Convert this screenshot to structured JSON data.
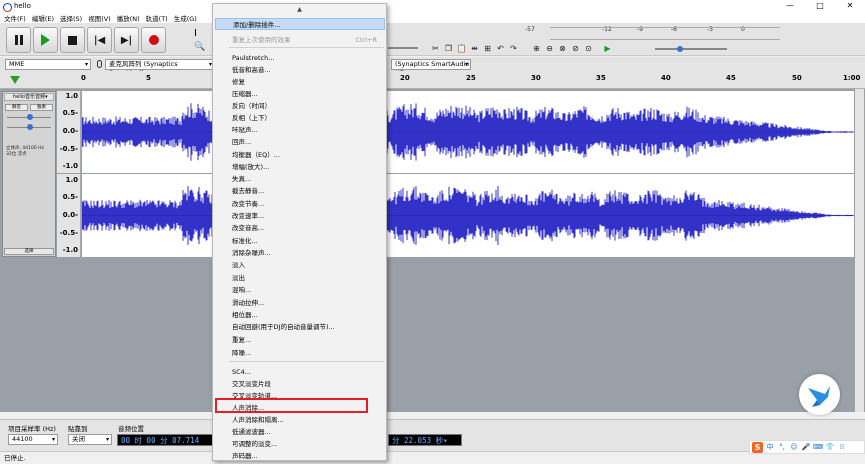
{
  "window": {
    "title": "hello",
    "minimize": "—",
    "maximize": "□",
    "close": "✕"
  },
  "menubar": [
    "文件(F)",
    "编辑(E)",
    "选择(S)",
    "视图(V)",
    "播放(N)",
    "轨道(T)",
    "生成(G)"
  ],
  "device": {
    "host": "MME",
    "input": "麦克风阵列 (Synaptics SmartAudio",
    "input_right": "(Synaptics SmartAudio HD"
  },
  "meter": {
    "minus57": "-57",
    "minus12": "-12",
    "minus9": "-9",
    "minus6": "-6",
    "minus3": "-3",
    "zero": "0"
  },
  "timeline": {
    "ticks": [
      "0",
      "5",
      "20",
      "25",
      "30",
      "35",
      "40",
      "45",
      "50",
      "55",
      "1:00"
    ]
  },
  "track": {
    "name": "hello音乐音频▾",
    "close": "✕",
    "mute": "静音",
    "solo": "独奏",
    "info_line1": "立体声, 44100 Hz",
    "info_line2": "32位 浮点",
    "select": "选择",
    "scale_labels": [
      "1.0",
      "0.5-",
      "0.0-",
      "-0.5-",
      "-1.0"
    ]
  },
  "context_menu": {
    "scroll_up": "▲",
    "items": [
      {
        "label": "添加/删除插件...",
        "shortcut": ""
      },
      {
        "label": "重复上次使用的效果",
        "shortcut": "Ctrl+R"
      },
      {
        "label": "Paulstretch...",
        "shortcut": ""
      },
      {
        "label": "低音和高音...",
        "shortcut": ""
      },
      {
        "label": "修复",
        "shortcut": ""
      },
      {
        "label": "压缩器...",
        "shortcut": ""
      },
      {
        "label": "反向（时间）",
        "shortcut": ""
      },
      {
        "label": "反相（上下）",
        "shortcut": ""
      },
      {
        "label": "咔哒声...",
        "shortcut": ""
      },
      {
        "label": "回声...",
        "shortcut": ""
      },
      {
        "label": "均衡器（EQ）...",
        "shortcut": ""
      },
      {
        "label": "增幅(放大)...",
        "shortcut": ""
      },
      {
        "label": "失真...",
        "shortcut": ""
      },
      {
        "label": "截去静音...",
        "shortcut": ""
      },
      {
        "label": "改变节奏...",
        "shortcut": ""
      },
      {
        "label": "改变速率...",
        "shortcut": ""
      },
      {
        "label": "改变音高...",
        "shortcut": ""
      },
      {
        "label": "标准化...",
        "shortcut": ""
      },
      {
        "label": "消除杂噪声...",
        "shortcut": ""
      },
      {
        "label": "淡入",
        "shortcut": ""
      },
      {
        "label": "淡出",
        "shortcut": ""
      },
      {
        "label": "混响...",
        "shortcut": ""
      },
      {
        "label": "滑动拉伸...",
        "shortcut": ""
      },
      {
        "label": "相位器...",
        "shortcut": ""
      },
      {
        "label": "自动回避(用于DJ的自动音量调节)...",
        "shortcut": ""
      },
      {
        "label": "重复...",
        "shortcut": ""
      },
      {
        "label": "降噪...",
        "shortcut": ""
      },
      {
        "label": "SC4...",
        "shortcut": ""
      },
      {
        "label": "交叉淡变片段",
        "shortcut": ""
      },
      {
        "label": "交叉淡变轨道...",
        "shortcut": ""
      },
      {
        "label": "人声消除...",
        "shortcut": ""
      },
      {
        "label": "人声消除和隔离...",
        "shortcut": ""
      },
      {
        "label": "低通滤波器...",
        "shortcut": ""
      },
      {
        "label": "可调整的淡变...",
        "shortcut": ""
      },
      {
        "label": "声码器...",
        "shortcut": ""
      }
    ]
  },
  "selection_bar": {
    "rate_label": "项目采样率 (Hz)",
    "rate_value": "44100",
    "snap_label": "贴靠到",
    "snap_value": "关闭",
    "pos_label": "音频位置",
    "pos_value": "00 时 00 分 07.714",
    "end_value": "分 22.053 秒▾"
  },
  "status": "已停止.",
  "ime": {
    "s": "S",
    "zh": "中",
    "punct": "°,",
    "emoji": "☺",
    "mic": "🎤",
    "kb": "⌨",
    "shirt": "👕",
    "grid": "⁞⁞"
  },
  "colors": {
    "waveform": "#3232c8",
    "highlight": "#c6dcf6",
    "annotation": "#e41e26"
  }
}
